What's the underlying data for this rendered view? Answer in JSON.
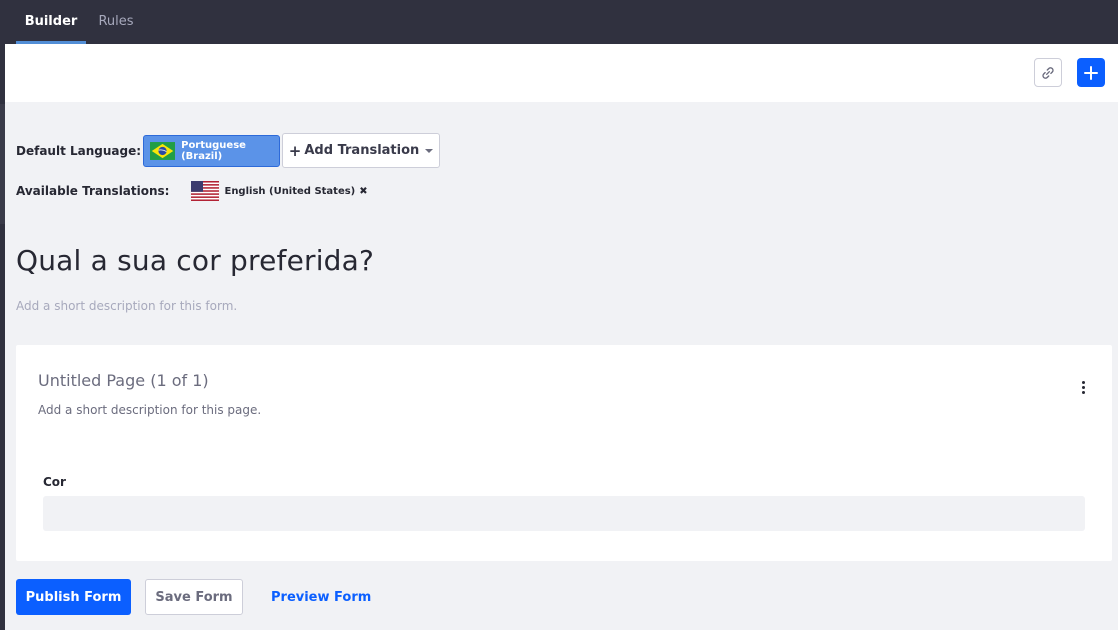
{
  "tabs": [
    {
      "label": "Builder",
      "active": true
    },
    {
      "label": "Rules",
      "active": false
    }
  ],
  "toolbar": {
    "link_icon": "link-icon",
    "add_icon": "plus-icon"
  },
  "language": {
    "default_label": "Default Language:",
    "default_value": "Portuguese (Brazil)",
    "default_flag": "brazil-flag-icon",
    "add_translation_label": "Add Translation",
    "available_label": "Available Translations:",
    "translations": [
      {
        "name": "English (United States)",
        "flag": "us-flag-icon"
      }
    ]
  },
  "form": {
    "title": "Qual a sua cor preferida?",
    "description_placeholder": "Add a short description for this form."
  },
  "page": {
    "title": "Untitled Page (1 of 1)",
    "description": "Add a short description for this page.",
    "fields": [
      {
        "label": "Cor",
        "value": ""
      }
    ]
  },
  "footer": {
    "publish_label": "Publish Form",
    "save_label": "Save Form",
    "preview_label": "Preview Form"
  },
  "colors": {
    "accent": "#0b5fff",
    "topbar": "#30313f",
    "language_button": "#5b93e8"
  }
}
